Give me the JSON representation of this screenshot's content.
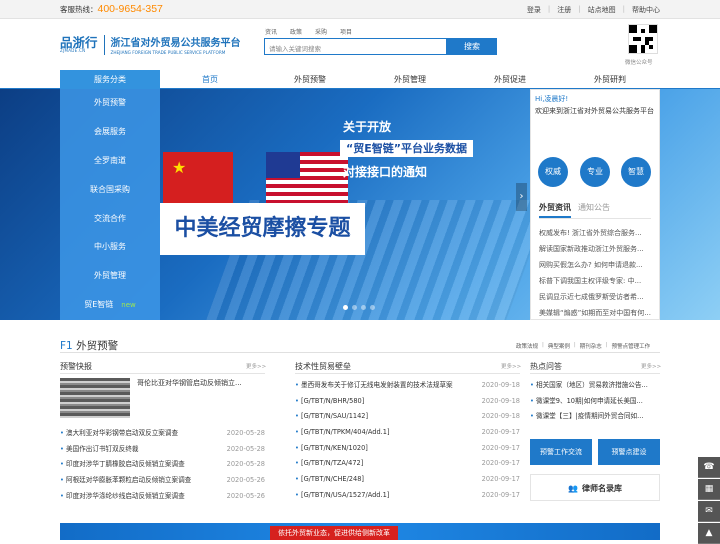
{
  "topbar": {
    "hotline_label": "客服热线：",
    "hotline_number": "400-9654-357",
    "links": [
      "登录",
      "注册",
      "站点地图",
      "帮助中心"
    ]
  },
  "logo": {
    "mark": "品浙行",
    "mark_sub": "ZJMADE.CN",
    "title": "浙江省对外贸易公共服务平台",
    "title_en": "ZHEJIANG FOREIGN TRADE PUBLIC SERVICE PLATFORM"
  },
  "search": {
    "tabs": [
      "资讯",
      "政策",
      "采购",
      "项目"
    ],
    "placeholder": "请输入关键词搜索",
    "button": "搜索"
  },
  "qr": {
    "caption": "微信公众号"
  },
  "nav": {
    "category": "服务分类",
    "items": [
      "首页",
      "外贸预警",
      "外贸管理",
      "外贸促进",
      "外贸研判"
    ]
  },
  "sidebar": {
    "items": [
      "外贸预警",
      "会展服务",
      "全罗南道",
      "联合国采购",
      "交流合作",
      "中小服务",
      "外贸管理",
      "贸E智链"
    ],
    "new_badge": "new"
  },
  "banner": {
    "line1": "关于开放",
    "line2": "“贸E智链”平台业务数据",
    "line3": "对接接口的通知",
    "special": "中美经贸摩擦专题",
    "arrow": "›"
  },
  "right_panel": {
    "greeting": "Hi,凌晨好!",
    "welcome": "欢迎来到浙江省对外贸易公共服务平台",
    "circles": [
      "权威",
      "专业",
      "智慧"
    ],
    "tab_active": "外贸资讯",
    "tab_inactive": "通知公告",
    "news": [
      "权威发布! 浙江省外贸综合服务...",
      "解读国家新政推动浙江外贸服务...",
      "网购买假怎么办? 如何申请退款...",
      "标普下调我国主权评级专家: 中...",
      "民调显示近七成俄罗斯受访者希...",
      "美媒辑“煽惑”如期而至对中国有何..."
    ]
  },
  "f1": {
    "prefix": "F1",
    "title": "外贸预警",
    "links": [
      "政策法规",
      "典型案例",
      "期刊杂志",
      "预警点管理工作"
    ]
  },
  "col1": {
    "title": "预警快报",
    "more": "更多>>",
    "feature_text": "哥伦比亚对华钢管启动反倾销立...",
    "rows": [
      {
        "t": "澳大利亚对华彩钢带启动双反立案调查",
        "d": "2020-05-28"
      },
      {
        "t": "美国作出订书钉双反终裁",
        "d": "2020-05-28"
      },
      {
        "t": "印度对涉华丁腈橡胶启动反倾销立案调查",
        "d": "2020-05-28"
      },
      {
        "t": "阿根廷对华膨胀苯颗粒启动反倾销立案调查",
        "d": "2020-05-26"
      },
      {
        "t": "印度对涉华涤纶纱线启动反倾销立案调查",
        "d": "2020-05-26"
      }
    ]
  },
  "col2": {
    "title": "技术性贸易壁垒",
    "more": "更多>>",
    "rows": [
      {
        "t": "墨西哥发布关于修订无线电发射装置的技术法规草案",
        "d": "2020-09-18"
      },
      {
        "t": "[G/TBT/N/BHR/580]",
        "d": "2020-09-18"
      },
      {
        "t": "[G/TBT/N/SAU/1142]",
        "d": "2020-09-18"
      },
      {
        "t": "[G/TBT/N/TPKM/404/Add.1]",
        "d": "2020-09-17"
      },
      {
        "t": "[G/TBT/N/KEN/1020]",
        "d": "2020-09-17"
      },
      {
        "t": "[G/TBT/N/TZA/472]",
        "d": "2020-09-17"
      },
      {
        "t": "[G/TBT/N/CHE/248]",
        "d": "2020-09-17"
      },
      {
        "t": "[G/TBT/N/USA/1527/Add.1]",
        "d": "2020-09-17"
      }
    ]
  },
  "col3": {
    "title": "热点问答",
    "more": "更多>>",
    "rows": [
      "相关国家（地区）贸易救济措施公告...",
      "微课堂9、10期|如何申请延长美国...",
      "微课堂【三】|疫情期间外贸合同如..."
    ],
    "btn1": "预警工作交流",
    "btn2": "预警点建设",
    "lawyer": "律师名录库"
  },
  "bottom_banner": "依托外贸新业态，促进供给侧新改革"
}
